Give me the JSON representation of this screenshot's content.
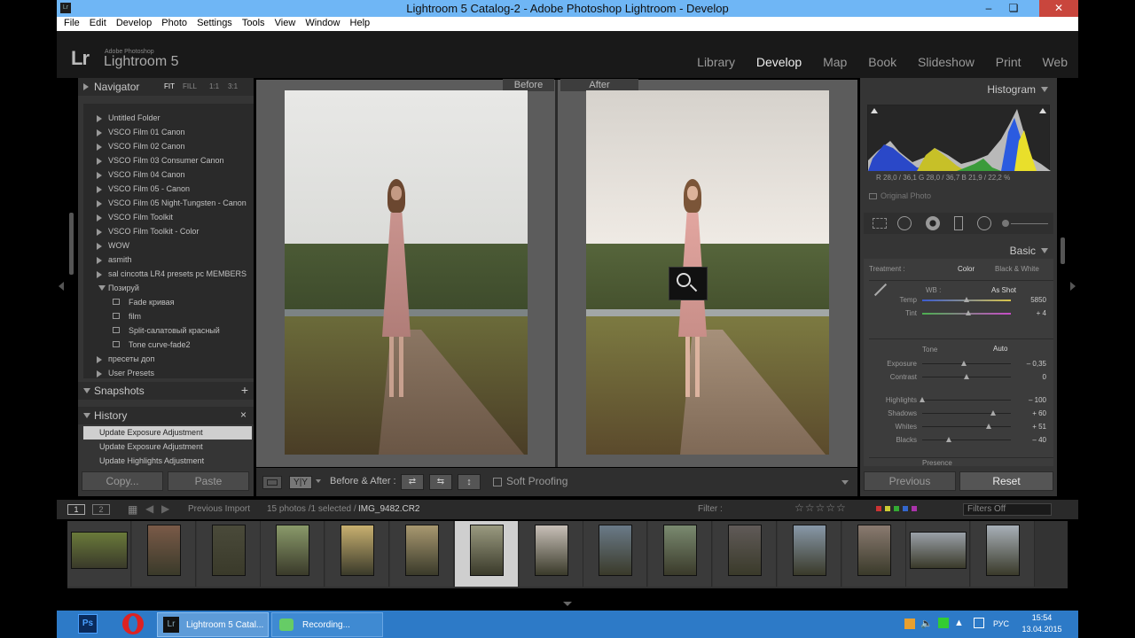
{
  "window": {
    "title": "Lightroom 5 Catalog-2 - Adobe Photoshop Lightroom - Develop"
  },
  "menu": [
    "File",
    "Edit",
    "Develop",
    "Photo",
    "Settings",
    "Tools",
    "View",
    "Window",
    "Help"
  ],
  "logo": {
    "mark": "Lr",
    "small": "Adobe Photoshop",
    "name": "Lightroom 5"
  },
  "modules": [
    "Library",
    "Develop",
    "Map",
    "Book",
    "Slideshow",
    "Print",
    "Web"
  ],
  "active_module": "Develop",
  "navigator": {
    "title": "Navigator",
    "zoom": [
      "FIT",
      "FILL",
      "1:1",
      "3:1"
    ]
  },
  "presets": {
    "top_items": [
      "Untitled Folder",
      "VSCO Film 01 Canon",
      "VSCO Film 02 Canon",
      "VSCO Film 03 Consumer Canon",
      "VSCO Film 04 Canon",
      "VSCO Film 05 - Canon",
      "VSCO Film 05 Night-Tungsten - Canon",
      "VSCO Film Toolkit",
      "VSCO Film Toolkit - Color",
      "WOW",
      "asmith",
      "sal cincotta LR4 presets pc MEMBERS"
    ],
    "open_folder": "Позируй",
    "sub_items": [
      "Fade кривая",
      "film",
      "Split-салатовый красный",
      "Tone curve-fade2"
    ],
    "bottom_items": [
      "пресеты доп",
      "User Presets"
    ]
  },
  "snapshots": {
    "title": "Snapshots",
    "add": "+"
  },
  "history": {
    "title": "History",
    "close": "×",
    "items": [
      "Update Exposure Adjustment",
      "Update Exposure Adjustment",
      "Update Highlights Adjustment"
    ]
  },
  "left_buttons": {
    "copy": "Copy...",
    "paste": "Paste"
  },
  "view_labels": {
    "before": "Before",
    "after": "After"
  },
  "toolbar": {
    "before_after": "Before & After :",
    "soft_proofing": "Soft Proofing"
  },
  "histogram": {
    "title": "Histogram",
    "readout": "R 28,0 / 36,1  G 28,0 / 36,7  B 21,9 / 22,2 %",
    "original": "Original Photo"
  },
  "basic": {
    "title": "Basic",
    "treatment_label": "Treatment :",
    "treatment_color": "Color",
    "treatment_bw": "Black & White",
    "wb_label": "WB :",
    "wb_value": "As Shot",
    "tone_label": "Tone",
    "auto": "Auto",
    "sliders": [
      {
        "name": "Temp",
        "value": "5850",
        "pos": 0.5
      },
      {
        "name": "Tint",
        "value": "+ 4",
        "pos": 0.52
      },
      {
        "name": "Exposure",
        "value": "– 0,35",
        "pos": 0.47
      },
      {
        "name": "Contrast",
        "value": "0",
        "pos": 0.5
      },
      {
        "name": "Highlights",
        "value": "– 100",
        "pos": 0.0
      },
      {
        "name": "Shadows",
        "value": "+ 60",
        "pos": 0.8
      },
      {
        "name": "Whites",
        "value": "+ 51",
        "pos": 0.75
      },
      {
        "name": "Blacks",
        "value": "– 40",
        "pos": 0.3
      }
    ],
    "presence": "Presence"
  },
  "right_buttons": {
    "previous": "Previous",
    "reset": "Reset"
  },
  "filmstrip_bar": {
    "page1": "1",
    "page2": "2",
    "source": "Previous Import",
    "count": "15 photos /1 selected /",
    "file": "IMG_9482.CR2",
    "filter_label": "Filter :",
    "filters_off": "Filters Off"
  },
  "taskbar": {
    "lightroom": "Lightroom 5 Catal...",
    "recording": "Recording...",
    "lang": "РУС",
    "time": "15:54",
    "date": "13.04.2015"
  },
  "colors": {
    "accent": "#6fb6f5",
    "panel": "#353535",
    "taskbar": "#2d7ac7"
  }
}
